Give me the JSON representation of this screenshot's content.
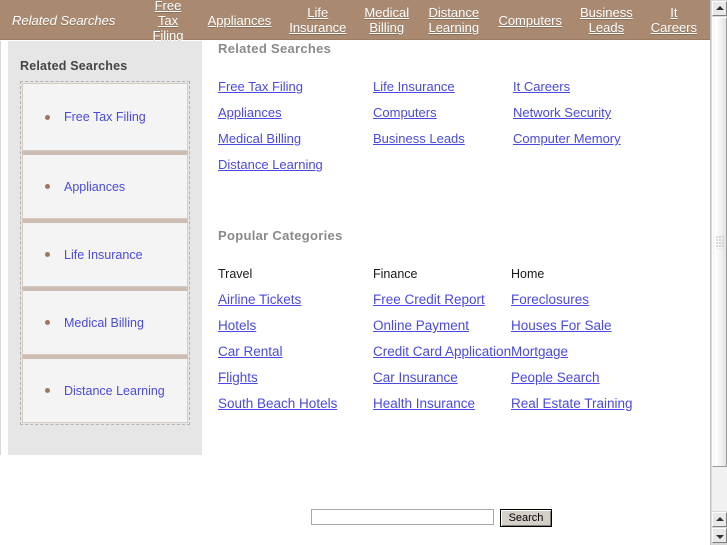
{
  "topbar": {
    "title": "Related Searches",
    "links": [
      "Free Tax Filing",
      "Appliances",
      "Life Insurance",
      "Medical Billing",
      "Distance Learning",
      "Computers",
      "Business Leads",
      "It Careers"
    ]
  },
  "sidebar": {
    "title": "Related Searches",
    "items": [
      "Free Tax Filing",
      "Appliances",
      "Life Insurance",
      "Medical Billing",
      "Distance Learning"
    ]
  },
  "main": {
    "related": {
      "heading": "Related Searches",
      "links": [
        "Free Tax Filing",
        "Life Insurance",
        "It Careers",
        "Appliances",
        "Computers",
        "Network Security",
        "Medical Billing",
        "Business Leads",
        "Computer Memory",
        "Distance Learning"
      ]
    },
    "popular": {
      "heading": "Popular Categories",
      "columns": [
        "Travel",
        "Finance",
        "Home"
      ],
      "links": [
        "Airline Tickets",
        "Free Credit Report",
        "Foreclosures",
        "Hotels",
        "Online Payment",
        "Houses For Sale",
        "Car Rental",
        "Credit Card Application",
        "Mortgage",
        "Flights",
        "Car Insurance",
        "People Search",
        "South Beach Hotels",
        "Health Insurance",
        "Real Estate Training"
      ]
    }
  },
  "search": {
    "value": "",
    "placeholder": "",
    "button_label": "Search"
  },
  "scrollbar": {
    "up_icon": "triangle-up",
    "down_icon": "triangle-down"
  },
  "colors": {
    "topbar_background": "#a98a70",
    "link": "#4a4ae0",
    "sidebar_background": "#e6e6e6",
    "separator": "#cdbcb2",
    "bullet": "#a0765c",
    "heading": "#8a8a8a"
  }
}
